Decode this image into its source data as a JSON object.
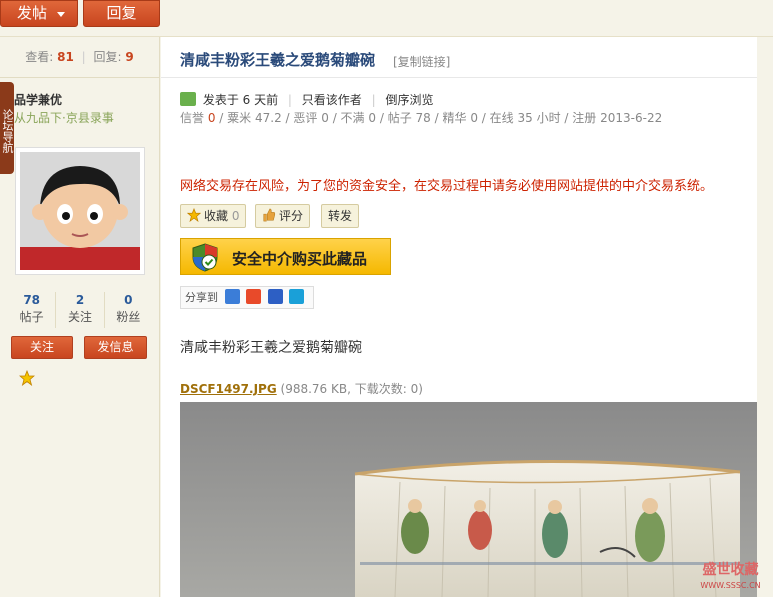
{
  "toolbar": {
    "post_label": "发帖",
    "reply_label": "回复"
  },
  "stats": {
    "views_label": "查看:",
    "views": "81",
    "replies_label": "回复:",
    "replies": "9"
  },
  "side_tab": "论坛导航",
  "author": {
    "name": "品学兼优",
    "rank": "从九品下·京县录事",
    "counts": [
      {
        "n": "78",
        "label": "帖子"
      },
      {
        "n": "2",
        "label": "关注"
      },
      {
        "n": "0",
        "label": "粉丝"
      }
    ],
    "follow_label": "关注",
    "message_label": "发信息"
  },
  "post": {
    "title": "清咸丰粉彩王羲之爱鹅菊瓣碗",
    "copy_link": "[复制链接]",
    "posted": "发表于 6 天前",
    "only_author": "只看该作者",
    "reverse": "倒序浏览",
    "meta": {
      "credit_label": "信誉",
      "credit": "0",
      "grain_label": "粟米",
      "grain": "47.2",
      "bad_label": "恶评",
      "bad": "0",
      "unsat_label": "不满",
      "unsat": "0",
      "posts_label": "帖子",
      "posts": "78",
      "digest_label": "精华",
      "digest": "0",
      "online_label": "在线",
      "online": "35 小时",
      "reg_label": "注册",
      "reg": "2013-6-22"
    },
    "warning": "网络交易存在风险，为了您的资金安全，在交易过程中请务必使用网站提供的中介交易系统。",
    "fav_label": "收藏",
    "fav_count": "0",
    "rate_label": "评分",
    "forward_label": "转发",
    "buy_banner": "安全中介购买此藏品",
    "share_label": "分享到",
    "body_text": "清咸丰粉彩王羲之爱鹅菊瓣碗",
    "attachment": {
      "name": "DSCF1497.JPG",
      "info": "(988.76 KB, 下载次数: 0)"
    }
  },
  "watermark": {
    "line1": "盛世收藏",
    "line2": "WWW.SSSC.CN"
  },
  "colors": {
    "accent": "#c8451f",
    "link": "#2a4a7a",
    "warning": "#cc2200"
  }
}
